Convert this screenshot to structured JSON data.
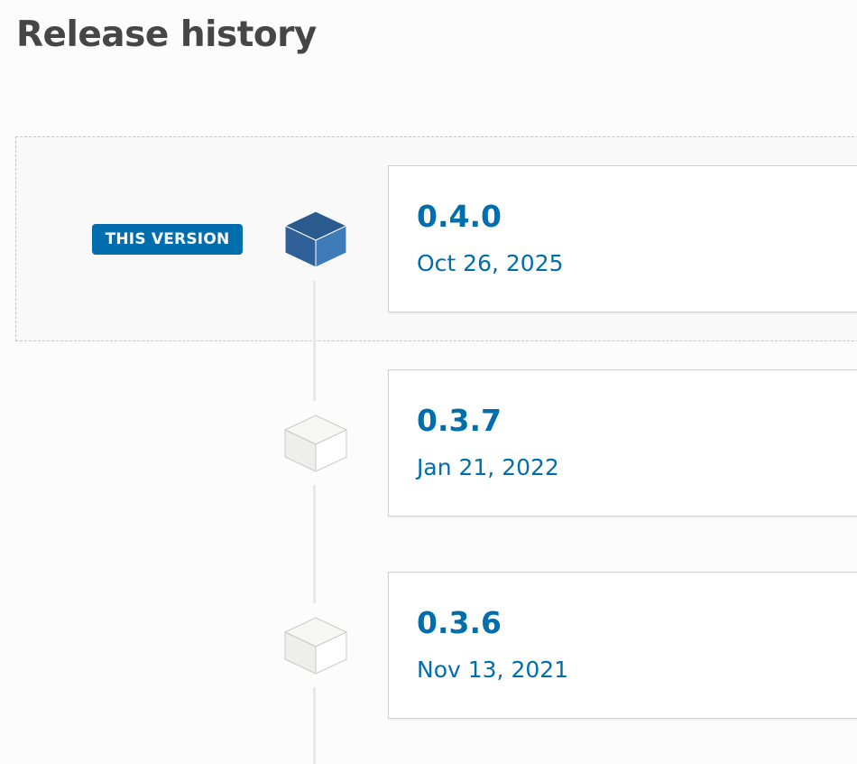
{
  "page_title": "Release history",
  "current_badge": "THIS VERSION",
  "releases": [
    {
      "version": "0.4.0",
      "date": "Oct 26, 2025",
      "current": true
    },
    {
      "version": "0.3.7",
      "date": "Jan 21, 2022",
      "current": false
    },
    {
      "version": "0.3.6",
      "date": "Nov 13, 2021",
      "current": false
    }
  ],
  "icons": {
    "current_release": "cube-icon-blue",
    "past_release": "cube-icon-grey"
  },
  "colors": {
    "accent": "#006dad",
    "cube_blue_top": "#2a5a8e",
    "cube_blue_front": "#2f6098",
    "cube_blue_right": "#3f7bb8",
    "cube_grey": "#f2f2f0",
    "heading": "#464646"
  }
}
